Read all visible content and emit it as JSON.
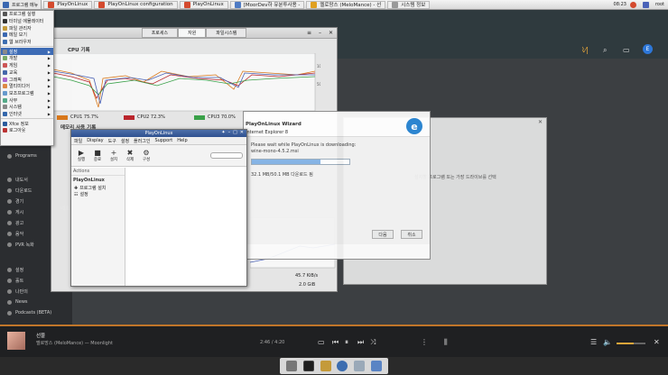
{
  "taskbar": {
    "start_label": "프로그램 메뉴",
    "tasks": [
      {
        "label": "PlayOnLinux",
        "color": "#d44a2e"
      },
      {
        "label": "PlayOnLinux configuration",
        "color": "#d44a2e"
      },
      {
        "label": "PlayOnLinux",
        "color": "#d44a2e"
      },
      {
        "label": "[MoorDev하 유분투사용 -",
        "color": "#4e7bc4"
      },
      {
        "label": "멜로망스 (MeloMance) - 선",
        "color": "#e0a020"
      },
      {
        "label": "시스템 정보",
        "color": "#999999"
      }
    ],
    "clock": "08:23",
    "user": "root"
  },
  "start_menu": {
    "items": [
      {
        "label": "프로그램 실행",
        "submenu": false
      },
      {
        "label": "터미널 에뮬레이터",
        "submenu": false
      },
      {
        "label": "파일 관리자",
        "submenu": false
      },
      {
        "label": "메일 보기",
        "submenu": false
      },
      {
        "label": "웹 브라우저",
        "submenu": false
      },
      {
        "label": "설정",
        "submenu": true
      },
      {
        "label": "개발",
        "submenu": true
      },
      {
        "label": "게임",
        "submenu": true
      },
      {
        "label": "교육",
        "submenu": true
      },
      {
        "label": "그래픽",
        "submenu": true
      },
      {
        "label": "멀티미디어",
        "submenu": true
      },
      {
        "label": "보조프로그램",
        "submenu": true
      },
      {
        "label": "사무",
        "submenu": true
      },
      {
        "label": "시스템",
        "submenu": true
      },
      {
        "label": "인터넷",
        "submenu": true
      },
      {
        "label": "Xfce 정보",
        "submenu": false
      },
      {
        "label": "로그아웃",
        "submenu": false
      }
    ]
  },
  "sysmon": {
    "tabs": [
      "프로세스",
      "자원",
      "파일시스템"
    ],
    "active_tab": 1,
    "cpu_section": "CPU 기록",
    "cpus": [
      {
        "label": "CPU1 75.7%",
        "color": "#e07b1a"
      },
      {
        "label": "CPU2 72.3%",
        "color": "#c0262d"
      },
      {
        "label": "CPU3 70.0%",
        "color": "#3aa64a"
      }
    ],
    "mem_section": "메모리 사용 기록",
    "net_section": "네트워크 사용 기록",
    "net_values": [
      "45.7 KiB/s",
      "2.0 GiB"
    ]
  },
  "pol": {
    "title": "PlayOnLinux",
    "menus": [
      "파일",
      "Display",
      "도구",
      "설정",
      "플러그인",
      "Support",
      "Help"
    ],
    "tools": [
      {
        "label": "실행",
        "glyph": "▶"
      },
      {
        "label": "중료",
        "glyph": "■"
      },
      {
        "label": "설치",
        "glyph": "+"
      },
      {
        "label": "삭제",
        "glyph": "✖"
      },
      {
        "label": "구성",
        "glyph": "⚙"
      }
    ],
    "left_header": "Actions",
    "left_title": "PlayOnLinux",
    "left_items": [
      "프로그램 설치",
      "설정"
    ]
  },
  "wizard": {
    "title": "PlayOnLinux Wizard",
    "subtitle": "Internet Explorer 8",
    "message": "Please wait while PlayOnLinux is downloading:",
    "file": "wine-mono-4.5.2.msi",
    "progress": 0.7,
    "status": "32.1 MB/50.1 MB 다운로드 됨",
    "btn_next": "다음",
    "btn_cancel": "취소"
  },
  "rightwin": {
    "text": "설치할 프로그램 또는 가장 드라이브를 선택"
  },
  "music": {
    "sidebar": [
      "Programs",
      "내도서",
      "다운로드",
      "경기",
      "게시",
      "광고",
      "음악",
      "PVR 녹화",
      "설정",
      "홀트",
      "나만의",
      "추천",
      "설정",
      "News",
      "Podcasts (BETA)"
    ],
    "track_title": "선물",
    "track_artist": "멜로망스 (MeloMance) — Moonlight",
    "time": "2:46 / 4:20"
  }
}
